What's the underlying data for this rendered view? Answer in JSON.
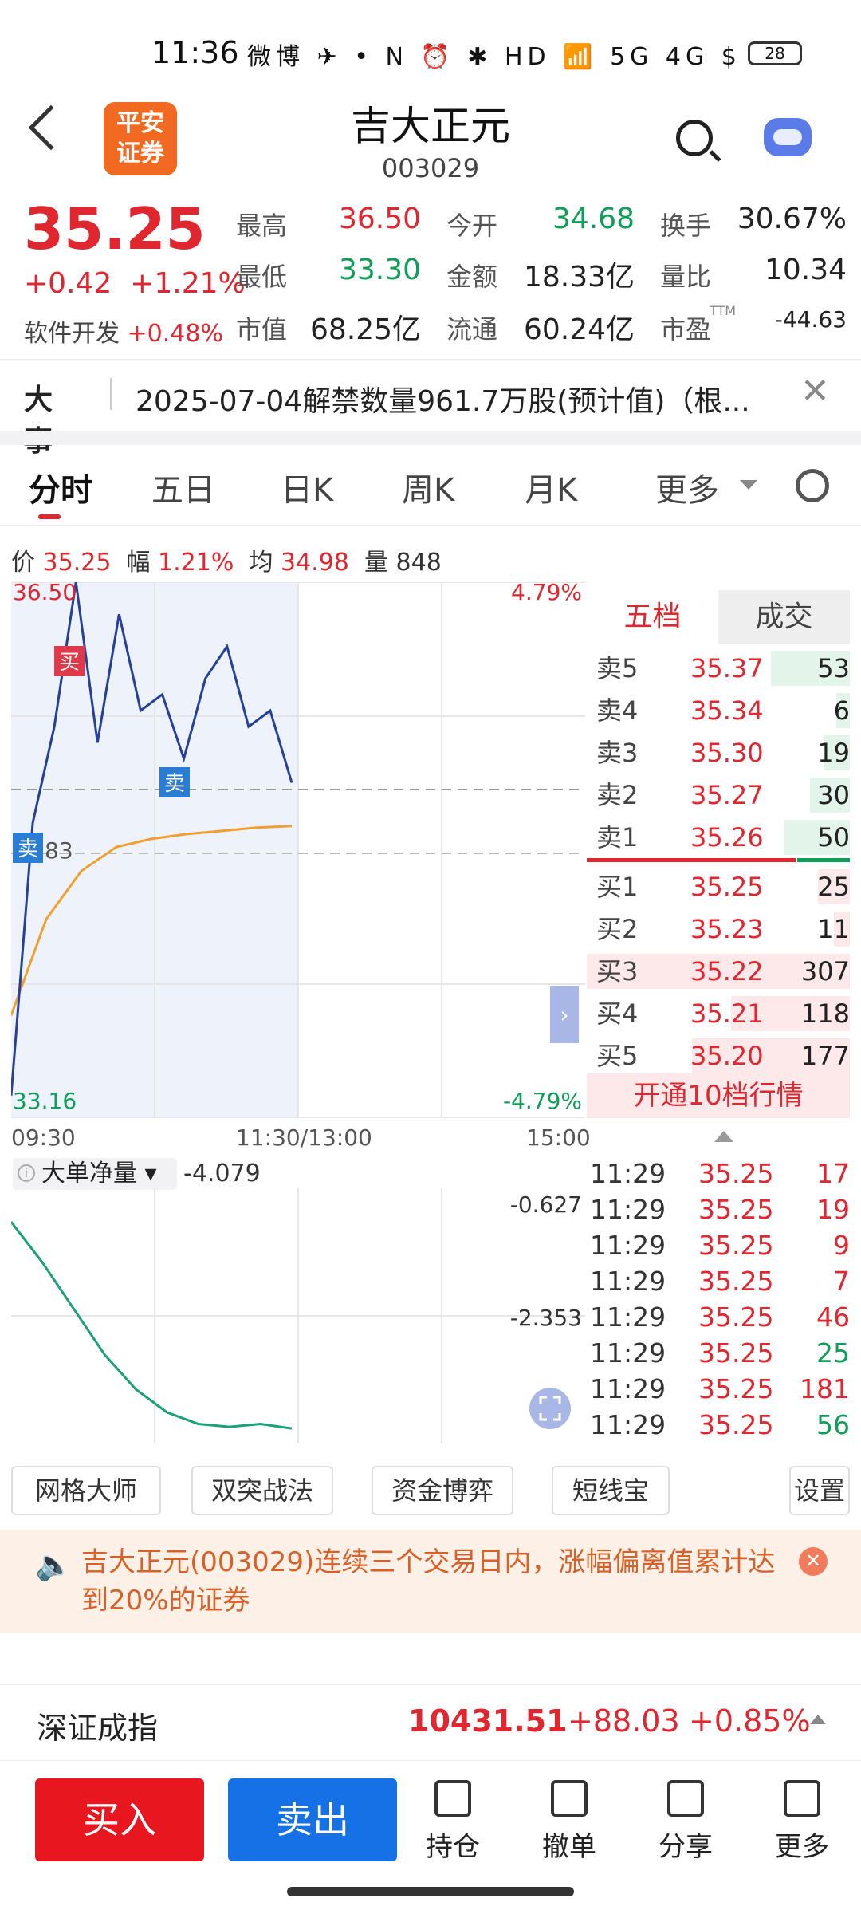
{
  "status_bar": {
    "time": "11:36",
    "icons": "微博 ✈ • N ⏰ ✱ HD 📶 5G 4G $",
    "battery": "28"
  },
  "header": {
    "logo": "平安\n证券",
    "title": "吉大正元",
    "code": "003029"
  },
  "quote": {
    "price": "35.25",
    "change": "+0.42",
    "change_pct": "+1.21%",
    "sector_label": "软件开发",
    "sector_pct": "+0.48%",
    "stats": [
      {
        "label": "最高",
        "value": "36.50",
        "color": "#e0262e"
      },
      {
        "label": "今开",
        "value": "34.68",
        "color": "#0f9d58"
      },
      {
        "label": "换手",
        "value": "30.67%",
        "color": "#222"
      },
      {
        "label": "最低",
        "value": "33.30",
        "color": "#0f9d58"
      },
      {
        "label": "金额",
        "value": "18.33亿",
        "color": "#222"
      },
      {
        "label": "量比",
        "value": "10.34",
        "color": "#222"
      },
      {
        "label": "市值",
        "value": "68.25亿",
        "color": "#222"
      },
      {
        "label": "流通",
        "value": "60.24亿",
        "color": "#222"
      },
      {
        "label": "市盈",
        "value": "-44.63",
        "color": "#222",
        "sup": "TTM"
      }
    ]
  },
  "event": {
    "label": "大事",
    "text": "2025-07-04解禁数量961.7万股(预计值)（根..."
  },
  "tabs": [
    "分时",
    "五日",
    "日K",
    "周K",
    "月K",
    "更多"
  ],
  "infoline": {
    "price_label": "价",
    "price": "35.25",
    "amp_label": "幅",
    "amp": "1.21%",
    "avg_label": "均",
    "avg": "34.98",
    "vol_label": "量",
    "vol": "848"
  },
  "chart_data": [
    {
      "type": "line",
      "x": [
        "09:30",
        "11:30/13:00",
        "15:00"
      ],
      "y_labels": {
        "top_left": "36.50",
        "bottom_left": "33.16",
        "top_right": "4.79%",
        "bottom_right": "-4.79%",
        "marker_value": "83"
      },
      "series": [
        {
          "values": [
            33.3,
            35.0,
            35.6,
            36.5,
            35.5,
            36.3,
            35.7,
            35.8,
            35.4,
            35.9,
            36.1,
            35.6,
            35.7,
            35.25
          ]
        },
        {
          "values": [
            33.8,
            34.4,
            34.7,
            34.85,
            34.9,
            34.93,
            34.95,
            34.97,
            34.98
          ]
        }
      ],
      "markers": [
        {
          "label": "买"
        },
        {
          "label": "卖"
        },
        {
          "label": "卖"
        }
      ]
    },
    {
      "type": "line",
      "title": "大单净量",
      "current": "-4.079",
      "y_labels": [
        "-0.627",
        "-2.353"
      ],
      "series": [
        {
          "values": [
            -0.5,
            -1.2,
            -2.0,
            -2.8,
            -3.4,
            -3.8,
            -4.0,
            -4.05,
            -4.0,
            -4.079
          ]
        }
      ]
    }
  ],
  "orderbook": {
    "tabs": [
      "五档",
      "成交"
    ],
    "asks": [
      {
        "label": "卖5",
        "price": "35.37",
        "vol": "53",
        "bar": 0.3
      },
      {
        "label": "卖4",
        "price": "35.34",
        "vol": "6",
        "bar": 0.05
      },
      {
        "label": "卖3",
        "price": "35.30",
        "vol": "19",
        "bar": 0.1
      },
      {
        "label": "卖2",
        "price": "35.27",
        "vol": "30",
        "bar": 0.15
      },
      {
        "label": "卖1",
        "price": "35.26",
        "vol": "50",
        "bar": 0.25
      }
    ],
    "bids": [
      {
        "label": "买1",
        "price": "35.25",
        "vol": "25",
        "bar": 0.12
      },
      {
        "label": "买2",
        "price": "35.23",
        "vol": "11",
        "bar": 0.06
      },
      {
        "label": "买3",
        "price": "35.22",
        "vol": "307",
        "bar": 1.0
      },
      {
        "label": "买4",
        "price": "35.21",
        "vol": "118",
        "bar": 0.45
      },
      {
        "label": "买5",
        "price": "35.20",
        "vol": "177",
        "bar": 0.6
      }
    ],
    "open10": "开通10档行情"
  },
  "ticks": [
    {
      "time": "11:29",
      "price": "35.25",
      "vol": "17",
      "color": "#e0262e"
    },
    {
      "time": "11:29",
      "price": "35.25",
      "vol": "19",
      "color": "#e0262e"
    },
    {
      "time": "11:29",
      "price": "35.25",
      "vol": "9",
      "color": "#e0262e"
    },
    {
      "time": "11:29",
      "price": "35.25",
      "vol": "7",
      "color": "#e0262e"
    },
    {
      "time": "11:29",
      "price": "35.25",
      "vol": "46",
      "color": "#e0262e"
    },
    {
      "time": "11:29",
      "price": "35.25",
      "vol": "25",
      "color": "#0f9d58"
    },
    {
      "time": "11:29",
      "price": "35.25",
      "vol": "181",
      "color": "#e0262e"
    },
    {
      "time": "11:29",
      "price": "35.25",
      "vol": "56",
      "color": "#0f9d58"
    }
  ],
  "tools": [
    "网格大师",
    "双突战法",
    "资金博弈",
    "短线宝",
    "设置"
  ],
  "notice": {
    "text": "吉大正元(003029)连续三个交易日内，涨幅偏离值累计达到20%的证券"
  },
  "index": {
    "name": "深证成指",
    "value": "10431.51",
    "change": "+88.03",
    "pct": "+0.85%"
  },
  "bottom": {
    "buy": "买入",
    "sell": "卖出",
    "items": [
      "持仓",
      "撤单",
      "分享",
      "更多"
    ]
  }
}
